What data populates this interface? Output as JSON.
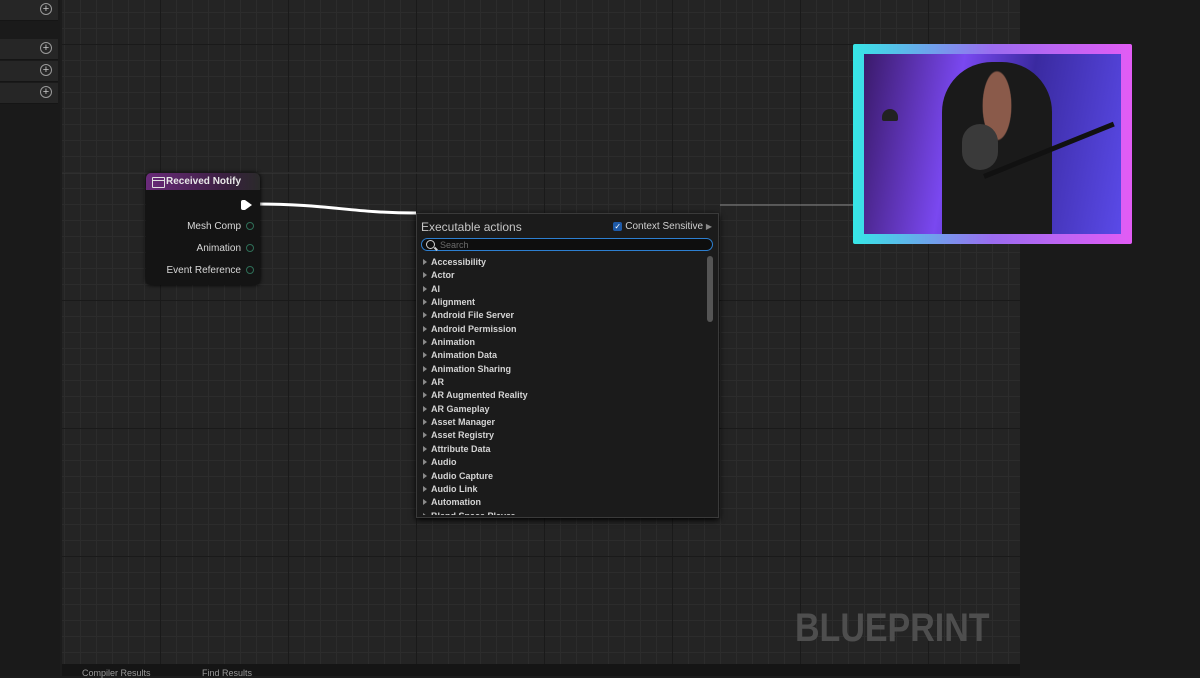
{
  "node": {
    "title": "Received Notify",
    "pins": [
      "Mesh Comp",
      "Animation",
      "Event Reference"
    ]
  },
  "menu": {
    "title": "Executable actions",
    "context_sensitive_label": "Context Sensitive",
    "search_placeholder": "Search",
    "items": [
      "Accessibility",
      "Actor",
      "AI",
      "Alignment",
      "Android File Server",
      "Android Permission",
      "Animation",
      "Animation Data",
      "Animation Sharing",
      "AR",
      "AR Augmented Reality",
      "AR Gameplay",
      "Asset Manager",
      "Asset Registry",
      "Attribute Data",
      "Audio",
      "Audio Capture",
      "Audio Link",
      "Automation",
      "Blend Space Player"
    ]
  },
  "watermark": "BLUEPRINT",
  "bottom_tabs": [
    "Compiler Results",
    "Find Results"
  ],
  "colors": {
    "accent": "#2d7fd0",
    "node_header": "#6a2a7a",
    "webcam_frame": "#9b6cf0"
  }
}
